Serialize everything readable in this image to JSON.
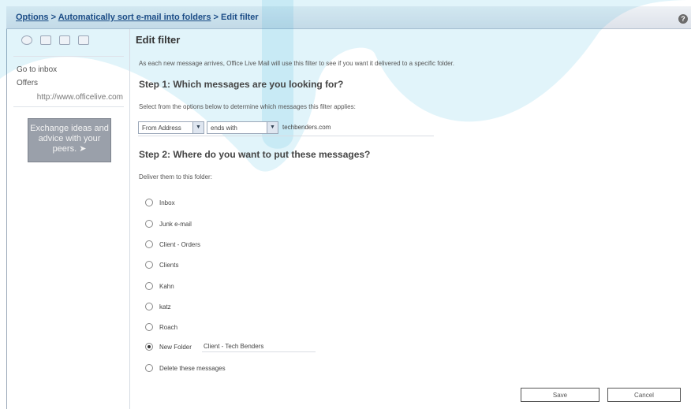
{
  "breadcrumb": {
    "options": "Options",
    "sep1": " > ",
    "sort_rules": "Automatically sort e-mail into folders",
    "sep2": " > ",
    "current": "Edit filter"
  },
  "help_icon": "?",
  "sidebar": {
    "go_to_inbox": "Go to inbox",
    "offers": "Offers",
    "offers_url": "http://www.officelive.com",
    "ad_text": "Exchange ideas and advice with your peers."
  },
  "main": {
    "title": "Edit filter",
    "description": "As each new message arrives, Office Live Mail will use this filter to see if you want it delivered to a specific folder.",
    "step1_title": "Step 1: Which messages are you looking for?",
    "step1_text": "Select from the options below to determine which messages this filter applies:",
    "filter": {
      "field_value": "From Address",
      "condition_value": "ends with",
      "text_value": "techbenders.com"
    },
    "step2_title": "Step 2: Where do you want to put these messages?",
    "step2_text": "Deliver them to this folder:",
    "folders": [
      {
        "label": "Inbox",
        "selected": false
      },
      {
        "label": "Junk e-mail",
        "selected": false
      },
      {
        "label": "Client - Orders",
        "selected": false
      },
      {
        "label": "Clients",
        "selected": false
      },
      {
        "label": "Kahn",
        "selected": false
      },
      {
        "label": "katz",
        "selected": false
      },
      {
        "label": "Roach",
        "selected": false
      },
      {
        "label": "New Folder",
        "selected": true
      },
      {
        "label": "Delete these messages",
        "selected": false
      }
    ],
    "new_folder_name": "Client - Tech Benders"
  },
  "buttons": {
    "save": "Save",
    "cancel": "Cancel"
  },
  "colors": {
    "watermark": "#1aa7d8",
    "link": "#1c3f7a"
  }
}
